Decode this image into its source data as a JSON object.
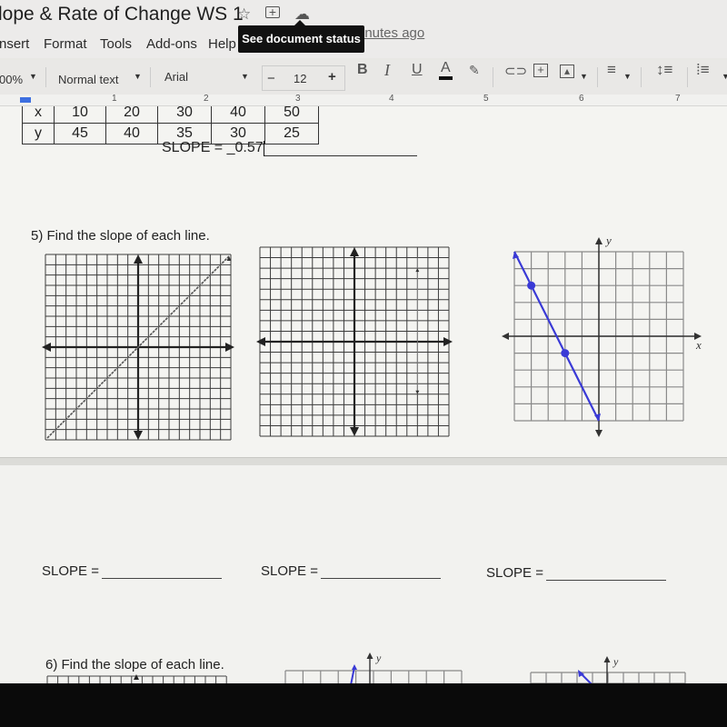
{
  "window": {
    "doc_title": "lope  & Rate of Change WS 1",
    "title_icons": [
      "star-icon",
      "move-to-folder-icon",
      "cloud-status-icon"
    ],
    "last_edit": "inutes ago",
    "tooltip": "See document status"
  },
  "menu": [
    "nsert",
    "Format",
    "Tools",
    "Add-ons",
    "Help"
  ],
  "toolbar": {
    "zoom": "00%",
    "style": "Normal text",
    "font": "Arial",
    "font_size": "12",
    "decrease": "−",
    "increase": "+",
    "bold": "B",
    "italic": "I",
    "underline": "U",
    "text_color": "A",
    "text_color_value": "#111111"
  },
  "ruler": [
    "1",
    "2",
    "3",
    "4",
    "5",
    "6",
    "7"
  ],
  "table": {
    "x_label": "x",
    "y_label": "y",
    "x_values": [
      "10",
      "20",
      "30",
      "40",
      "50"
    ],
    "y_values": [
      "45",
      "40",
      "35",
      "30",
      "25"
    ]
  },
  "slope_answer": {
    "label": "SLOPE = ",
    "value": "_0.57"
  },
  "question5": {
    "title": "5) Find the slope of each line.",
    "graphs": [
      {
        "type": "grid-line",
        "grid": 18,
        "line": "through origin, slope 1 (dashed-gray)"
      },
      {
        "type": "grid-line",
        "grid": 18,
        "line": "vertical at x=6 (faint)"
      },
      {
        "type": "grid-line",
        "grid": 10,
        "axis_x": "x",
        "axis_y": "y",
        "points": [
          [
            -4,
            3
          ],
          [
            -2,
            -1
          ]
        ],
        "line_color": "#3a3ad6"
      }
    ],
    "slope_labels": [
      "SLOPE =",
      "SLOPE =",
      "SLOPE ="
    ]
  },
  "question6": {
    "title": "6) Find the slope of each line.",
    "axis_y": "y"
  }
}
